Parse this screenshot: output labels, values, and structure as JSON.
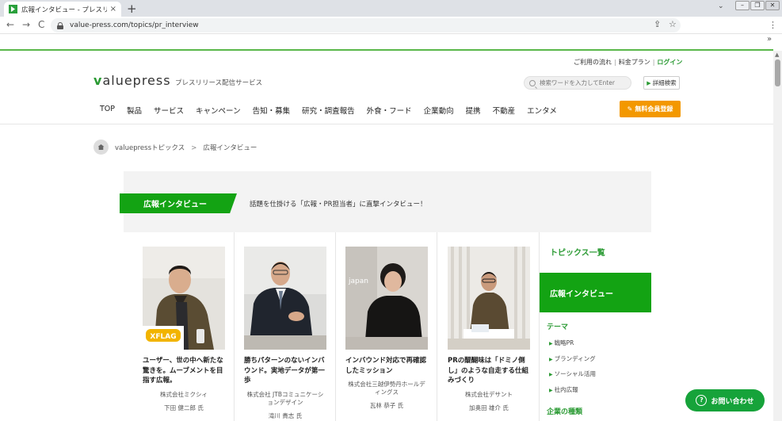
{
  "browser": {
    "tab_title": "広報インタビュー - プレスリリース配信",
    "tab_close": "×",
    "new_tab": "+",
    "tab_dropdown": "⌄",
    "url": "value-press.com/topics/pr_interview",
    "back": "←",
    "forward": "→",
    "reload": "C",
    "share": "⇪",
    "bookmark": "☆",
    "menu": "⋮",
    "extensions": "»",
    "minimize": "–",
    "maximize": "❐",
    "close": "✕"
  },
  "header": {
    "util_links": [
      "ご利用の流れ",
      "料金プラン",
      "ログイン"
    ],
    "logo_v": "v",
    "logo_rest": "aluepress",
    "tagline": "プレスリリース配信サービス",
    "search_placeholder": "検索ワードを入力してEnter",
    "advanced_search": "詳細検索",
    "nav": [
      "TOP",
      "製品",
      "サービス",
      "キャンペーン",
      "告知・募集",
      "研究・調査報告",
      "外食・フード",
      "企業動向",
      "提携",
      "不動産",
      "エンタメ"
    ],
    "register": "無料会員登録"
  },
  "breadcrumb": {
    "items": [
      "valuepressトピックス",
      "広報インタビュー"
    ],
    "sep": ">"
  },
  "banner": {
    "tag": "広報インタビュー",
    "desc": "話題を仕掛ける「広報・PR担当者」に直撃インタビュー！"
  },
  "cards": [
    {
      "title": "ユーザー、世の中へ新たな驚きを。ムーブメントを目指す広報。",
      "company": "株式会社ミクシィ",
      "person": "下田 健二郎 氏",
      "photo_label": "XFLAG"
    },
    {
      "title": "勝ちパターンのないインバウンド。実地データが第一歩",
      "company": "株式会社 JTBコミュニケーションデザイン",
      "person": "滝川 貴志 氏",
      "photo_label": ""
    },
    {
      "title": "インバウンド対応で再確認したミッション",
      "company": "株式会社三越伊勢丹ホールディングス",
      "person": "瓦林 恭子 氏",
      "photo_label": "japan"
    },
    {
      "title": "PRの醍醐味は「ドミノ倒し」のような自走する仕組みづくり",
      "company": "株式会社デサント",
      "person": "加奥田 雄介 氏",
      "photo_label": ""
    }
  ],
  "sidebar": {
    "list_title": "トピックス一覧",
    "active": "広報インタビュー",
    "theme_heading": "テーマ",
    "theme_items": [
      "戦略PR",
      "ブランディング",
      "ソーシャル活用",
      "社内広報"
    ],
    "type_heading": "企業の種類",
    "arrow": "▶"
  },
  "contact": {
    "label": "お問い合わせ",
    "icon": "?"
  }
}
